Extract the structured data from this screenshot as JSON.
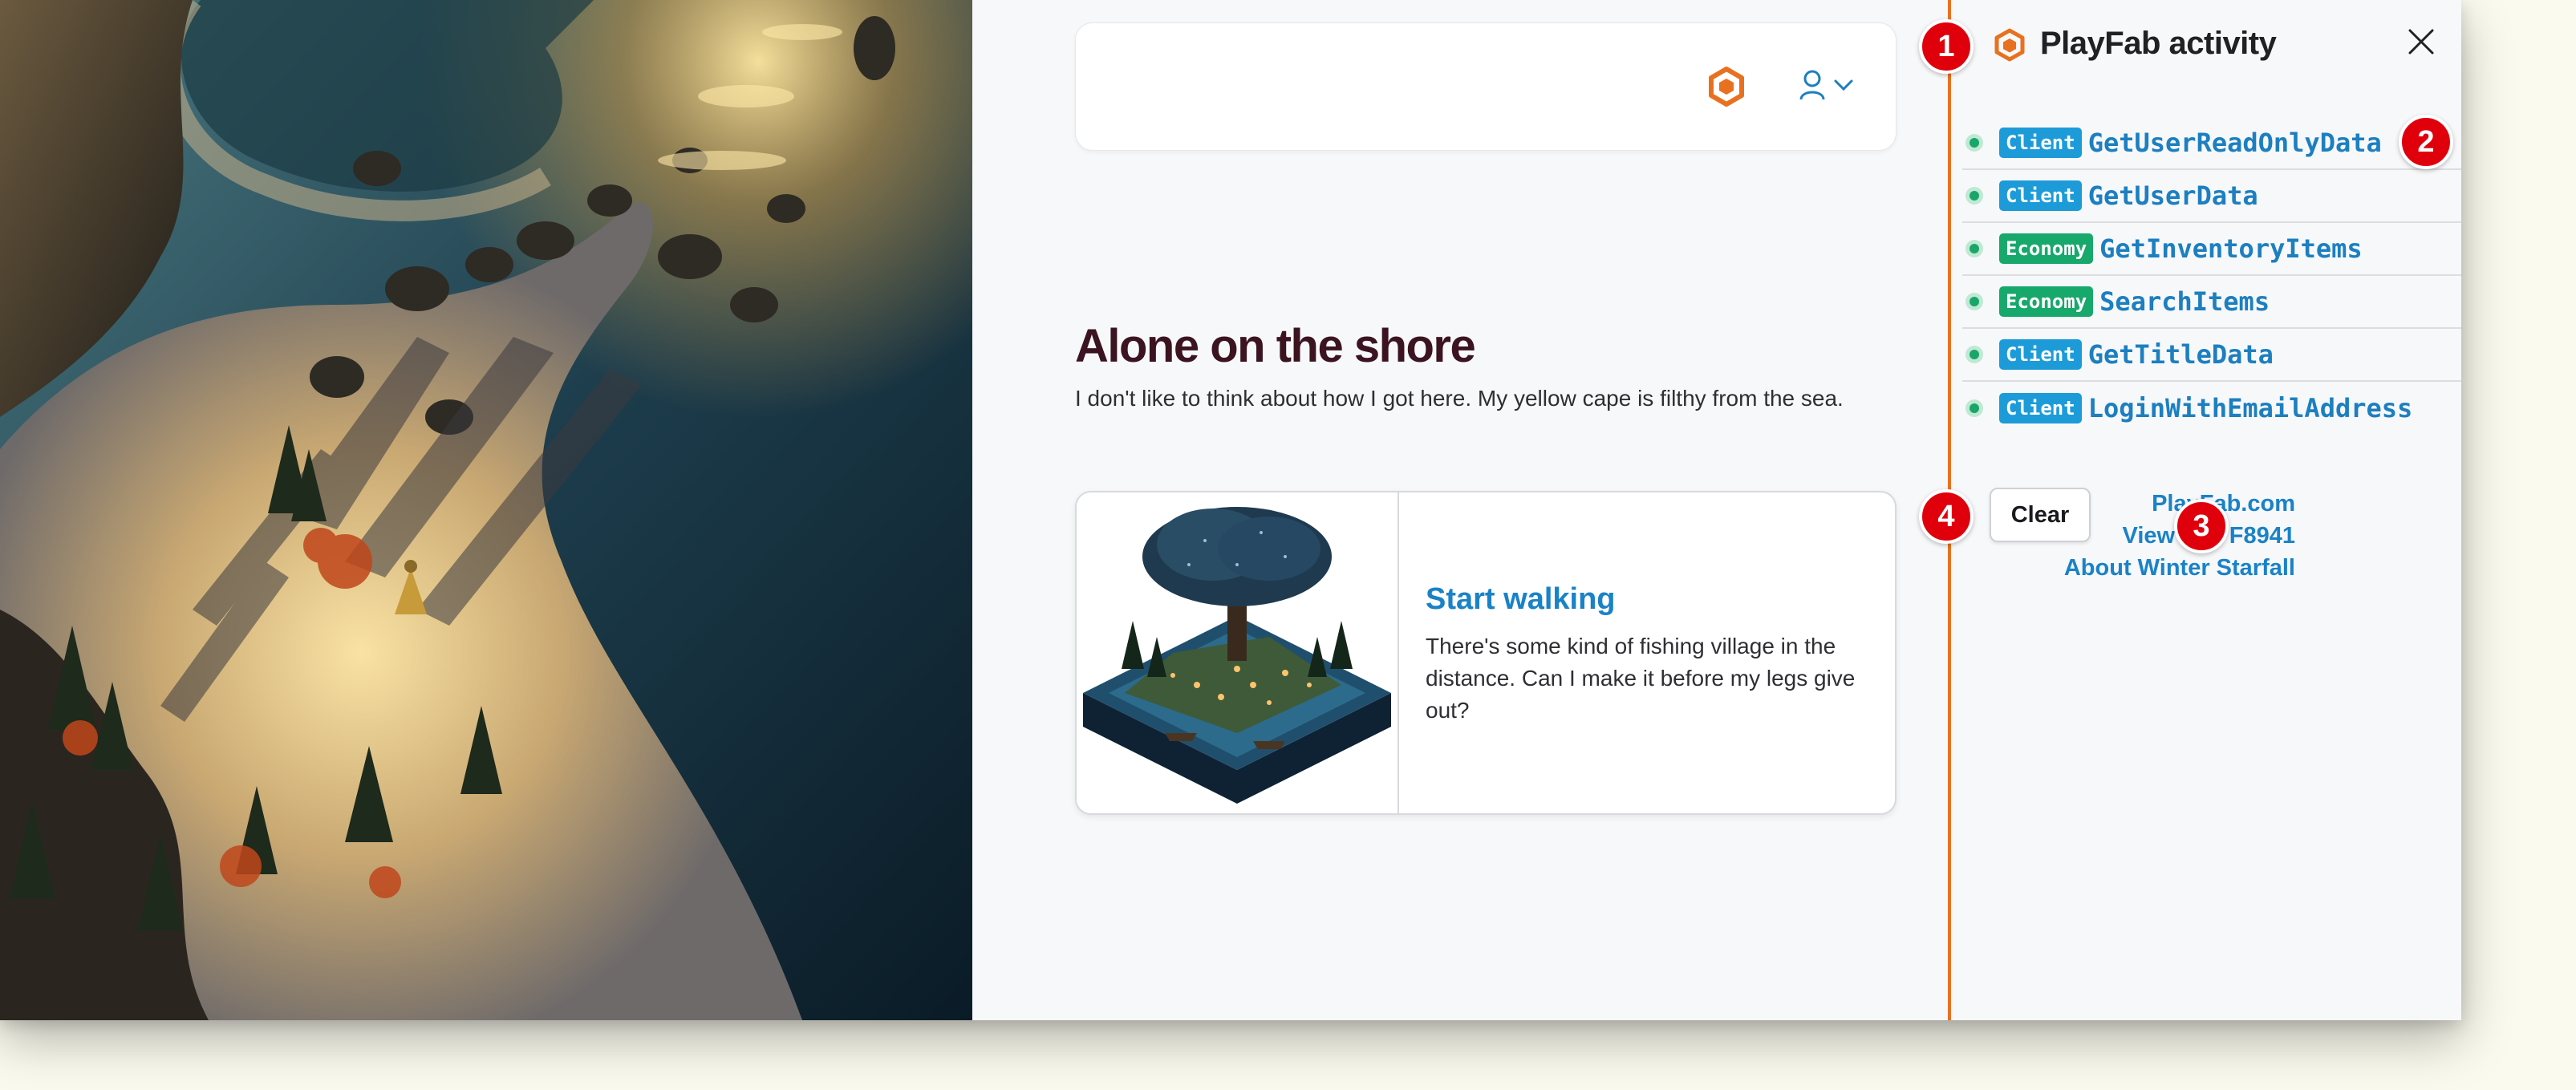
{
  "header": {
    "logo_icon": "playfab-hexagon-icon",
    "user_icon": "user-icon",
    "chevron_icon": "chevron-down-icon"
  },
  "scene": {
    "title": "Alone on the shore",
    "description": "I don't like to think about how I got here. My yellow cape is filthy from the sea."
  },
  "choice": {
    "title": "Start walking",
    "text": "There's some kind of fishing village in the distance. Can I make it before my legs give out?"
  },
  "panel": {
    "title": "PlayFab activity",
    "close_icon": "close-icon",
    "activities": [
      {
        "tag": "Client",
        "api": "GetUserReadOnlyData"
      },
      {
        "tag": "Client",
        "api": "GetUserData"
      },
      {
        "tag": "Economy",
        "api": "GetInventoryItems"
      },
      {
        "tag": "Economy",
        "api": "SearchItems"
      },
      {
        "tag": "Client",
        "api": "GetTitleData"
      },
      {
        "tag": "Client",
        "api": "LoginWithEmailAddress"
      }
    ],
    "clear_label": "Clear",
    "links": [
      "PlayFab.com",
      "View title F8941",
      "About Winter Starfall"
    ]
  },
  "callouts": [
    "1",
    "2",
    "3",
    "4"
  ],
  "colors": {
    "accent_orange": "#e8711f",
    "link_blue": "#1a82c7",
    "client_tag": "#1d9bd9",
    "economy_tag": "#17a86b",
    "title_maroon": "#3b1420",
    "callout_red": "#e0000c"
  }
}
